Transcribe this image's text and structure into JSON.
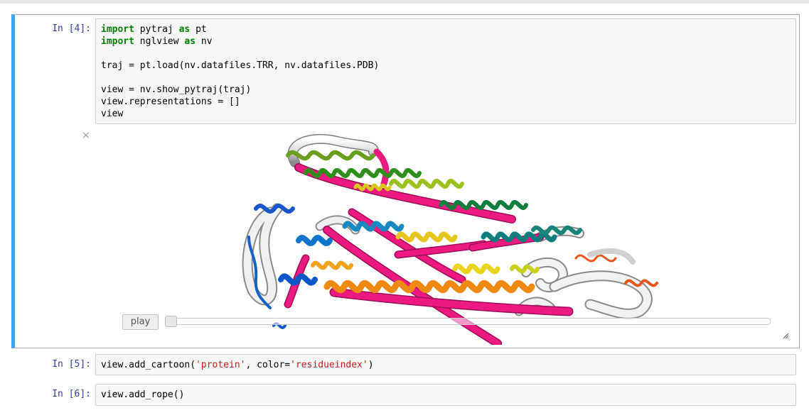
{
  "cells": [
    {
      "prompt": "In [4]:",
      "code_lines": [
        [
          {
            "t": "import",
            "c": "kw"
          },
          {
            "t": " pytraj ",
            "c": ""
          },
          {
            "t": "as",
            "c": "kw"
          },
          {
            "t": " pt",
            "c": ""
          }
        ],
        [
          {
            "t": "import",
            "c": "kw"
          },
          {
            "t": " nglview ",
            "c": ""
          },
          {
            "t": "as",
            "c": "kw"
          },
          {
            "t": " nv",
            "c": ""
          }
        ],
        [],
        [
          {
            "t": "traj = pt.load(nv.datafiles.TRR, nv.datafiles.PDB)",
            "c": ""
          }
        ],
        [],
        [
          {
            "t": "view = nv.show_pytraj(traj)",
            "c": ""
          }
        ],
        [
          {
            "t": "view.representations = []",
            "c": ""
          }
        ],
        [
          {
            "t": "view",
            "c": ""
          }
        ]
      ]
    },
    {
      "prompt": "In [5]:",
      "code_lines": [
        [
          {
            "t": "view.add_cartoon(",
            "c": ""
          },
          {
            "t": "'protein'",
            "c": "str"
          },
          {
            "t": ", color=",
            "c": ""
          },
          {
            "t": "'residueindex'",
            "c": "str"
          },
          {
            "t": ")",
            "c": ""
          }
        ]
      ]
    },
    {
      "prompt": "In [6]:",
      "code_lines": [
        [
          {
            "t": "view.add_rope()",
            "c": ""
          }
        ]
      ]
    }
  ],
  "output": {
    "close_symbol": "×",
    "play_label": "play",
    "frame_fraction": 0.0
  },
  "icons": {
    "close": "close-icon",
    "resize": "resize-grip-icon"
  },
  "colors": {
    "selected_border": "#42a5f5",
    "prompt": "#303f9f",
    "keyword": "#008000",
    "string": "#ba2121",
    "rope": "#e8197a",
    "tube": "#e8e8e8"
  }
}
